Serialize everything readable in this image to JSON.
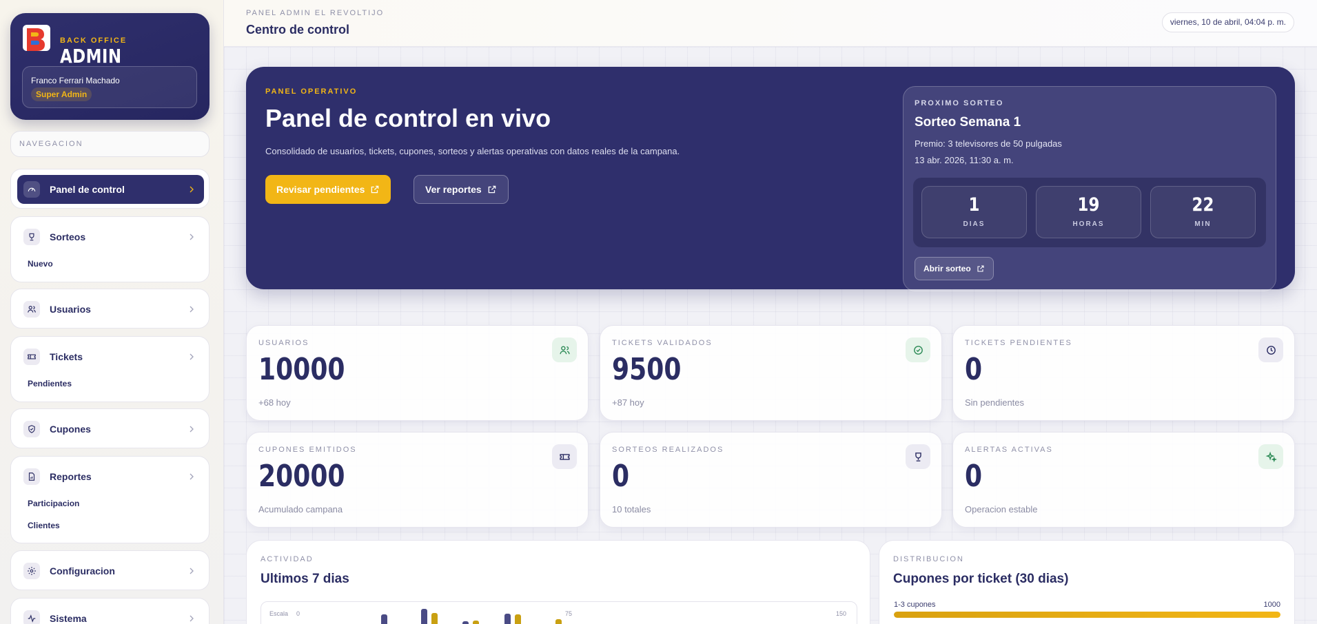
{
  "sidebar": {
    "brand_kicker": "BACK OFFICE",
    "brand_title": "ADMIN",
    "user_name": "Franco Ferrari Machado",
    "user_role": "Super Admin",
    "nav_label": "NAVEGACION",
    "items": [
      {
        "label": "Panel de control",
        "icon": "gauge-icon",
        "active": true
      },
      {
        "label": "Sorteos",
        "icon": "trophy-icon",
        "sub": [
          "Nuevo"
        ]
      },
      {
        "label": "Usuarios",
        "icon": "users-icon"
      },
      {
        "label": "Tickets",
        "icon": "ticket-icon",
        "sub": [
          "Pendientes"
        ]
      },
      {
        "label": "Cupones",
        "icon": "shield-icon"
      },
      {
        "label": "Reportes",
        "icon": "file-chart-icon",
        "sub": [
          "Participacion",
          "Clientes"
        ]
      },
      {
        "label": "Configuracion",
        "icon": "gear-icon"
      },
      {
        "label": "Sistema",
        "icon": "activity-icon"
      }
    ]
  },
  "header": {
    "kicker": "PANEL ADMIN EL REVOLTIJO",
    "title": "Centro de control",
    "date": "viernes, 10 de abril, 04:04 p. m."
  },
  "hero": {
    "kicker": "PANEL OPERATIVO",
    "title": "Panel de control en vivo",
    "description": "Consolidado de usuarios, tickets, cupones, sorteos y alertas operativas con datos reales de la campana.",
    "primary_button": "Revisar pendientes",
    "secondary_button": "Ver reportes"
  },
  "next_draw": {
    "kicker": "PROXIMO SORTEO",
    "title": "Sorteo Semana 1",
    "prize": "Premio: 3 televisores de 50 pulgadas",
    "date": "13 abr. 2026, 11:30 a. m.",
    "countdown": [
      {
        "value": "1",
        "label": "DIAS"
      },
      {
        "value": "19",
        "label": "HORAS"
      },
      {
        "value": "22",
        "label": "MIN"
      }
    ],
    "button": "Abrir sorteo"
  },
  "stats": [
    {
      "label": "USUARIOS",
      "value": "10000",
      "sub": "+68 hoy",
      "icon": "users-icon",
      "accent": "#2e8b57"
    },
    {
      "label": "TICKETS VALIDADOS",
      "value": "9500",
      "sub": "+87 hoy",
      "icon": "check-circle-icon",
      "accent": "#2e8b57"
    },
    {
      "label": "TICKETS PENDIENTES",
      "value": "0",
      "sub": "Sin pendientes",
      "icon": "clock-icon",
      "accent": "#2b2d63"
    },
    {
      "label": "CUPONES EMITIDOS",
      "value": "20000",
      "sub": "Acumulado campana",
      "icon": "ticket-icon",
      "accent": "#2b2d63"
    },
    {
      "label": "SORTEOS REALIZADOS",
      "value": "0",
      "sub": "10 totales",
      "icon": "trophy-icon",
      "accent": "#2b2d63"
    },
    {
      "label": "ALERTAS ACTIVAS",
      "value": "0",
      "sub": "Operacion estable",
      "icon": "sparkle-icon",
      "accent": "#2e8b57"
    }
  ],
  "activity": {
    "kicker": "ACTIVIDAD",
    "title": "Ultimos 7 dias",
    "scale_label": "Escala",
    "ticks": [
      "0",
      "75",
      "150"
    ]
  },
  "distribution": {
    "kicker": "DISTRIBUCION",
    "title": "Cupones por ticket (30 dias)",
    "rows": [
      {
        "label": "1-3 cupones",
        "value": "1000",
        "fraction": 1.0
      }
    ]
  },
  "colors": {
    "navy": "#2f2f6c",
    "accent": "#f2b616",
    "success": "#2e8b57"
  }
}
